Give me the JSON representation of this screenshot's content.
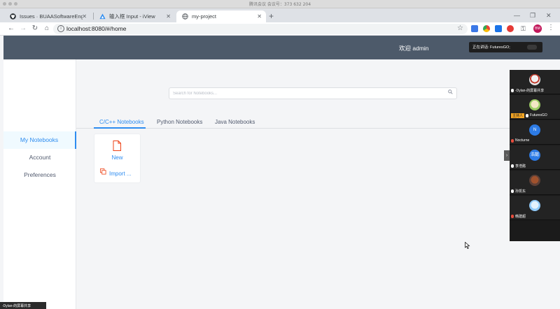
{
  "titlebar": {
    "caption": "腾讯会议 会议号：373 632 204"
  },
  "browser": {
    "tabs": [
      {
        "label": "Issues · BUAASoftwareEnginee",
        "icon": "github-icon"
      },
      {
        "label": "输入框 Input - iView",
        "icon": "iview-icon"
      },
      {
        "label": "my-project",
        "icon": "globe-icon"
      }
    ],
    "url": "localhost:8080/#/home"
  },
  "header": {
    "welcome": "欢迎 admin"
  },
  "speaking": {
    "text": "正在讲话: FuturesGO;"
  },
  "sidebar": {
    "items": [
      {
        "label": "My Notebooks",
        "active": true
      },
      {
        "label": "Account",
        "active": false
      },
      {
        "label": "Preferences",
        "active": false
      }
    ]
  },
  "search": {
    "placeholder": "Search for Notebooks..."
  },
  "notebook_tabs": [
    {
      "label": "C/C++ Notebooks",
      "active": true
    },
    {
      "label": "Python Notebooks",
      "active": false
    },
    {
      "label": "Java Notebooks",
      "active": false
    }
  ],
  "card": {
    "new_label": "New",
    "import_label": "Import ..."
  },
  "participants": [
    {
      "name": "-Dylan-的屏幕共享",
      "type": "avatar"
    },
    {
      "name": "FuturesGO",
      "type": "avatar",
      "tag": "主持人"
    },
    {
      "name": "Nocturne",
      "type": "initial",
      "initial": "N"
    },
    {
      "name": "李浩懿",
      "type": "initial",
      "initial": "浩懿"
    },
    {
      "name": "孙凯东",
      "type": "avatar"
    },
    {
      "name": "韩建超",
      "type": "avatar"
    }
  ],
  "share_bar": {
    "text": "-Dylan-的屏幕共享"
  },
  "colors": {
    "accent": "#2d8cf0",
    "header": "#4d5a6a",
    "profile": "#c2185b"
  }
}
